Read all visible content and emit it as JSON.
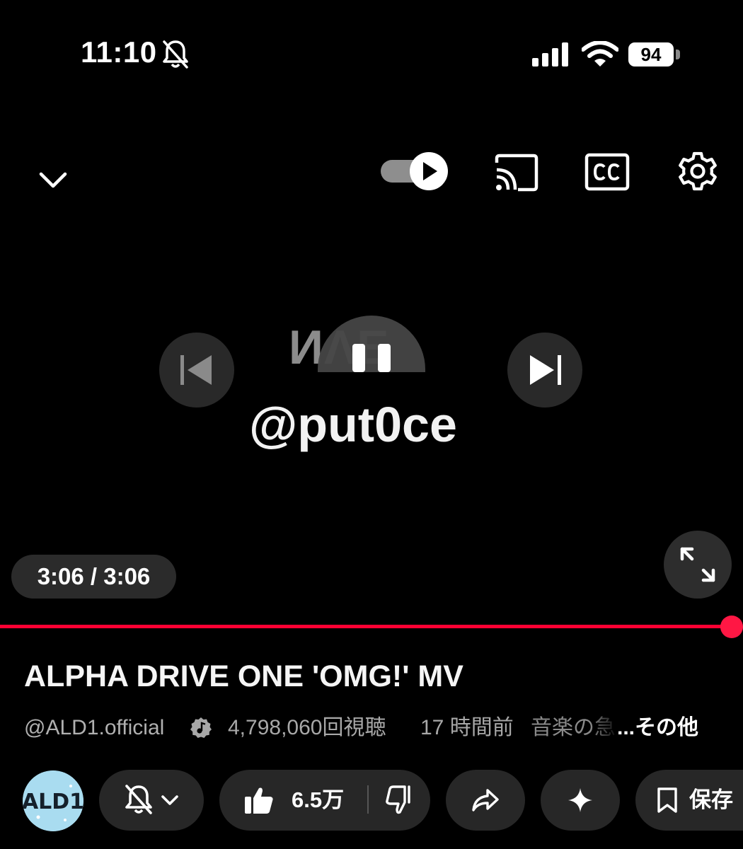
{
  "status_bar": {
    "time": "11:10",
    "battery_level": "94",
    "icons": [
      "bell-off-icon",
      "signal-icon",
      "wifi-icon",
      "battery-icon"
    ]
  },
  "player": {
    "top_controls": [
      "chevron-down-icon",
      "autoplay-toggle",
      "cast-icon",
      "cc-icon",
      "settings-icon"
    ],
    "artwork_text": "ИΛE",
    "watermark": "@put0ce",
    "time_display": "3:06 / 3:06",
    "progress_fraction": 1.0,
    "accent_color": "#ff0033"
  },
  "video": {
    "title": "ALPHA DRIVE ONE 'OMG!' MV",
    "channel_handle": "@ALD1.official",
    "views": "4,798,060回視聴",
    "age": "17 時間前",
    "category": "音楽の急",
    "more_label": "...その他"
  },
  "actions": {
    "avatar_text": "ALD1",
    "like_count": "6.5万",
    "save_label": "保存"
  }
}
